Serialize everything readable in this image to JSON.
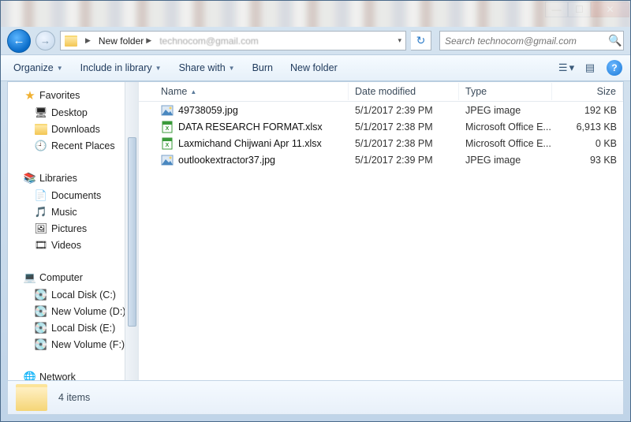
{
  "breadcrumb": {
    "items": [
      "New folder",
      "technocom@gmail.com"
    ]
  },
  "search": {
    "placeholder": "Search technocom@gmail.com"
  },
  "toolbar": {
    "organize": "Organize",
    "include": "Include in library",
    "share": "Share with",
    "burn": "Burn",
    "newfolder": "New folder"
  },
  "nav": {
    "favorites": {
      "label": "Favorites",
      "items": [
        "Desktop",
        "Downloads",
        "Recent Places"
      ]
    },
    "libraries": {
      "label": "Libraries",
      "items": [
        "Documents",
        "Music",
        "Pictures",
        "Videos"
      ]
    },
    "computer": {
      "label": "Computer",
      "items": [
        "Local Disk (C:)",
        "New Volume (D:)",
        "Local Disk (E:)",
        "New Volume (F:)"
      ]
    },
    "network": {
      "label": "Network"
    }
  },
  "columns": {
    "name": "Name",
    "date": "Date modified",
    "type": "Type",
    "size": "Size"
  },
  "files": [
    {
      "icon": "jpg",
      "name": "49738059.jpg",
      "date": "5/1/2017 2:39 PM",
      "type": "JPEG image",
      "size": "192 KB"
    },
    {
      "icon": "xlsx",
      "name": "DATA RESEARCH FORMAT.xlsx",
      "date": "5/1/2017 2:38 PM",
      "type": "Microsoft Office E...",
      "size": "6,913 KB"
    },
    {
      "icon": "xlsx",
      "name": "Laxmichand Chijwani Apr 11.xlsx",
      "date": "5/1/2017 2:38 PM",
      "type": "Microsoft Office E...",
      "size": "0 KB"
    },
    {
      "icon": "jpg",
      "name": "outlookextractor37.jpg",
      "date": "5/1/2017 2:39 PM",
      "type": "JPEG image",
      "size": "93 KB"
    }
  ],
  "details": {
    "count": "4 items"
  }
}
